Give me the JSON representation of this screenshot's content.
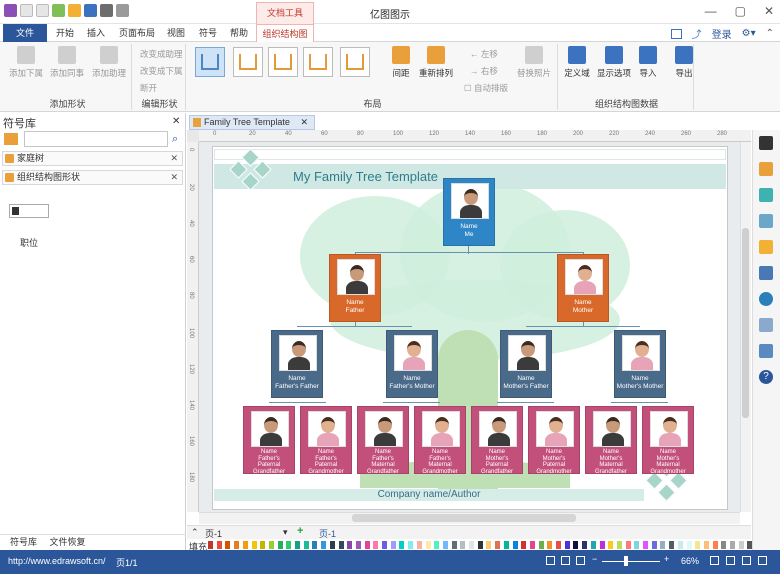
{
  "app": {
    "title": "亿图图示",
    "context_tab": "文档工具",
    "window_controls": [
      "—",
      "▢",
      "✕"
    ]
  },
  "tabs": [
    "文件",
    "开始",
    "插入",
    "页面布局",
    "视图",
    "符号",
    "帮助",
    "组织结构图"
  ],
  "active_tab": "组织结构图",
  "header_right": {
    "login": "登录"
  },
  "ribbon": {
    "groups": [
      {
        "label": "添加形状",
        "buttons": [
          "添加下属",
          "添加同事",
          "添加助理"
        ]
      },
      {
        "label": "编辑形状",
        "buttons": [
          "改变成助理",
          "改变成下属",
          "断开"
        ]
      },
      {
        "label": "布局",
        "buttons": [
          "间距",
          "重新排列",
          "左移",
          "右移",
          "自动排版",
          "替换照片"
        ]
      },
      {
        "label": "组织结构图数据",
        "buttons": [
          "定义域",
          "显示选项",
          "导入",
          "导出"
        ]
      }
    ]
  },
  "left_panel": {
    "title": "符号库",
    "search_placeholder": "",
    "libraries": [
      "家庭树",
      "组织结构图形状"
    ],
    "shape_label": "职位",
    "bottom_tabs": [
      "符号库",
      "文件恢复"
    ]
  },
  "document": {
    "tab_title": "Family Tree Template",
    "page_title": "My Family Tree Template",
    "footer": "Company name/Author"
  },
  "page_tabs": {
    "current": "页-1",
    "tab": "页-1",
    "add": "+"
  },
  "fill_label": "填充",
  "nodes": {
    "me": [
      "Name",
      "Me"
    ],
    "father": [
      "Name",
      "Father"
    ],
    "mother": [
      "Name",
      "Mother"
    ],
    "ff": [
      "Name",
      "Father's Father"
    ],
    "fm": [
      "Name",
      "Father's Mother"
    ],
    "mf": [
      "Name",
      "Mother's Father"
    ],
    "mm": [
      "Name",
      "Mother's Mother"
    ],
    "g1": [
      "Name",
      "Father's",
      "Paternal",
      "Grandfather"
    ],
    "g2": [
      "Name",
      "Father's",
      "Paternal",
      "Grandmother"
    ],
    "g3": [
      "Name",
      "Father's",
      "Maternal",
      "Grandfather"
    ],
    "g4": [
      "Name",
      "Father's",
      "Maternal",
      "Grandmother"
    ],
    "g5": [
      "Name",
      "Mother's",
      "Paternal",
      "Grandfather"
    ],
    "g6": [
      "Name",
      "Mother's",
      "Paternal",
      "Grandmother"
    ],
    "g7": [
      "Name",
      "Mother's",
      "Maternal",
      "Grandfather"
    ],
    "g8": [
      "Name",
      "Mother's",
      "Maternal",
      "Grandmother"
    ]
  },
  "colors": {
    "blue_node": "#2f86c6",
    "orange_node": "#d9692a",
    "slate_node": "#4a6a8a",
    "pink_node": "#c2507a",
    "accent": "#2b579a"
  },
  "status": {
    "url": "http://www.edrawsoft.cn/",
    "page": "页1/1",
    "zoom": "66%"
  },
  "ruler_ticks": [
    "0",
    "20",
    "40",
    "60",
    "80",
    "100",
    "120",
    "140",
    "160",
    "180",
    "200",
    "220",
    "240",
    "260",
    "280"
  ]
}
